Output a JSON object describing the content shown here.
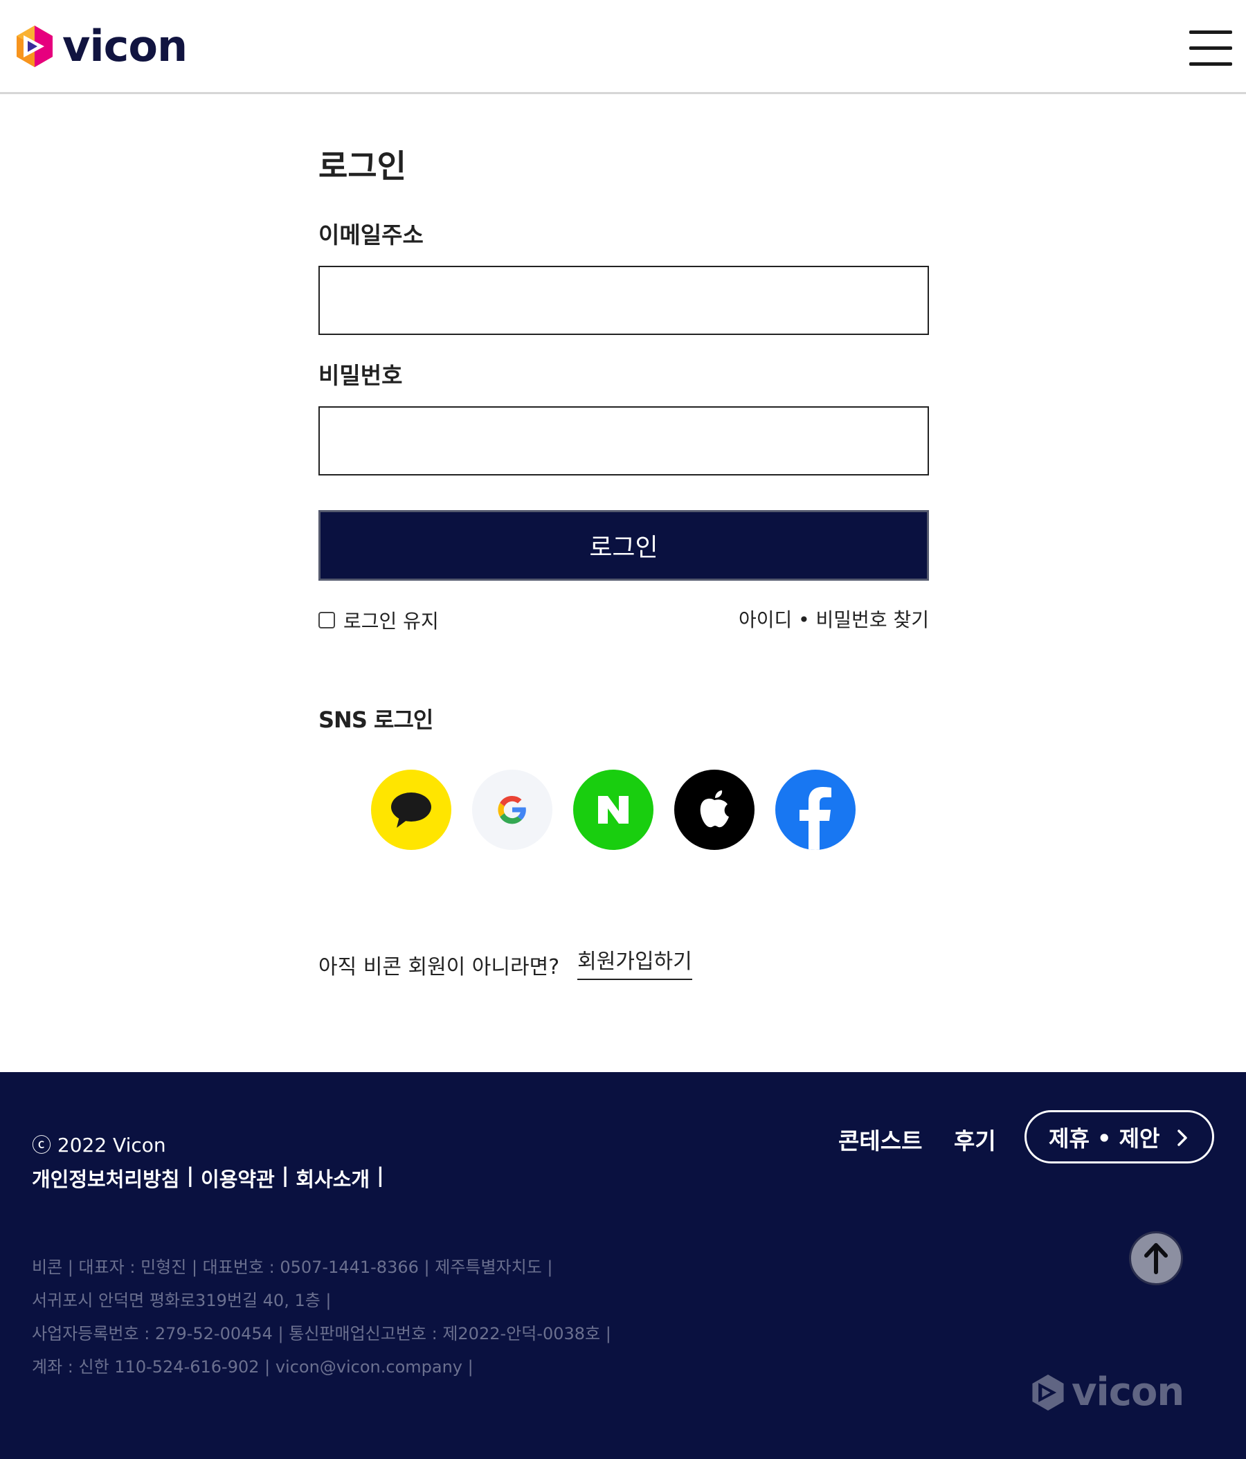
{
  "header": {
    "logo_text": "vicon",
    "menu_icon": "hamburger-menu-icon"
  },
  "login": {
    "title": "로그인",
    "email_label": "이메일주소",
    "email_value": "",
    "password_label": "비밀번호",
    "password_value": "",
    "submit_label": "로그인",
    "remember_label": "로그인 유지",
    "find_label": "아이디 • 비밀번호 찾기"
  },
  "sns": {
    "title": "SNS 로그인",
    "providers": [
      {
        "name": "kakao",
        "icon": "kakao-icon",
        "color": "#ffe500"
      },
      {
        "name": "google",
        "icon": "google-icon",
        "color": "#f3f5f9"
      },
      {
        "name": "naver",
        "icon": "naver-icon",
        "label": "N",
        "color": "#19ce0f"
      },
      {
        "name": "apple",
        "icon": "apple-icon",
        "color": "#000000"
      },
      {
        "name": "facebook",
        "icon": "facebook-icon",
        "color": "#1877f2"
      }
    ]
  },
  "signup": {
    "question": "아직 비콘 회원이 아니라면?",
    "link": "회원가입하기"
  },
  "footer": {
    "copyright": "ⓒ 2022 Vicon",
    "policy_links": [
      "개인정보처리방침",
      "이용약관",
      "회사소개"
    ],
    "separator": "|",
    "nav": {
      "contest": "콘테스트",
      "review": "후기",
      "partner": "제휴 • 제안"
    },
    "company_info": [
      "비콘 | 대표자 : 민형진 | 대표번호 : 0507-1441-8366 | 제주특별자치도 |",
      "서귀포시 안덕면 평화로319번길 40, 1층 |",
      "사업자등록번호 : 279-52-00454 | 통신판매업신고번호 : 제2022-안덕-0038호 |",
      "계좌 : 신한 110-524-616-902 | vicon@vicon.company |"
    ],
    "logo_text": "vicon"
  },
  "colors": {
    "navy": "#0a1140",
    "accent_orange": "#f7941d",
    "accent_magenta": "#e6007e",
    "accent_purple": "#3a2c9a"
  }
}
